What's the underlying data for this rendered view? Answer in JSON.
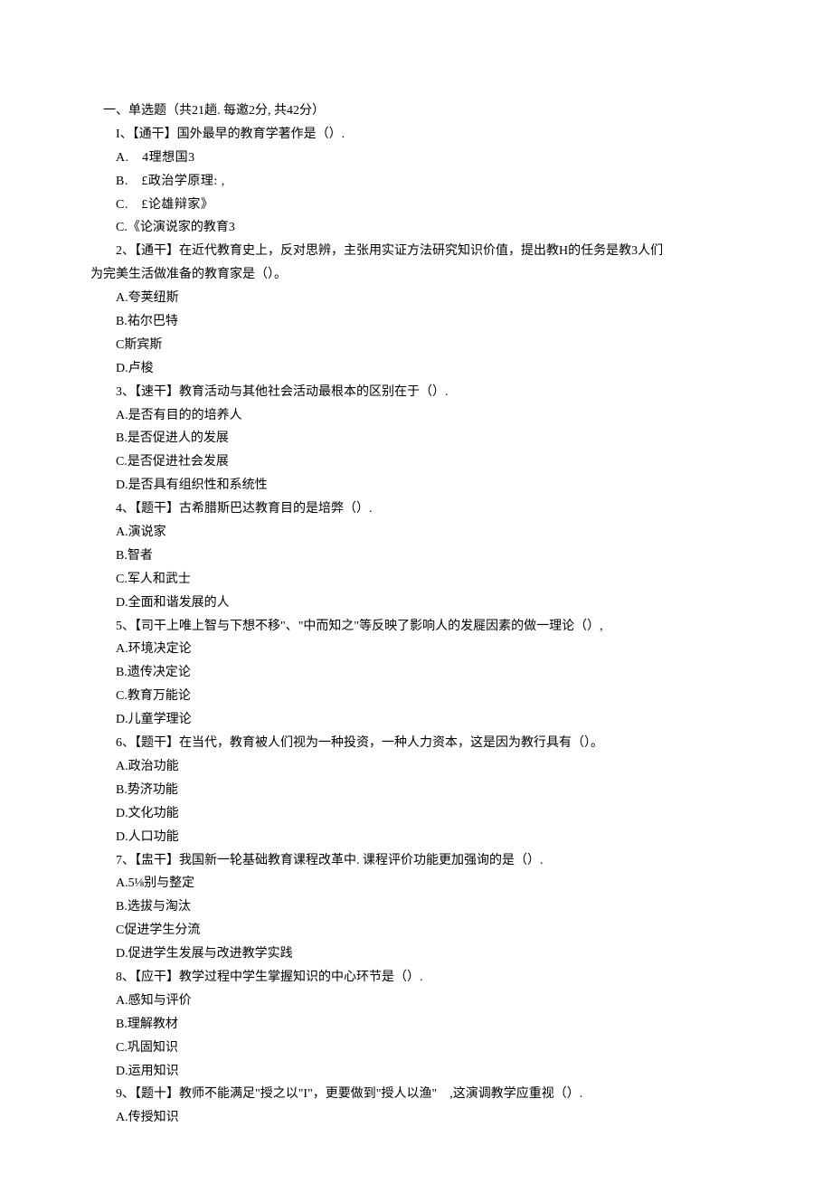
{
  "section_header": "一、单选题（共21趟. 每邀2分, 共42分）",
  "questions": [
    {
      "stem": "I、【通干】国外最早的教育学著作是（）.",
      "options": [
        "A.　4理想国3",
        "B.　£政治学原理: ,",
        "C.　£论雄辩家》",
        "C.《论演说家的教育3"
      ]
    },
    {
      "stem": "2、【通干】在近代教育史上，反对思辨，主张用实证方法研究知识价值，提出教H的任务是教3人们",
      "continuation": "为完美生活做准备的教育家是（）。",
      "options": [
        "A.夸荚纽斯",
        "B.祐尔巴特",
        "C斯宾斯",
        "D.卢梭"
      ]
    },
    {
      "stem": "3、【速干】教育活动与其他社会活动最根本的区别在于（）.",
      "options": [
        "A.是否有目的的培养人",
        "B.是否促进人的发展",
        "C.是否促进社会发展",
        "D.是否具有组织性和系统性"
      ]
    },
    {
      "stem": "4、【题干】古希腊斯巴达教育目的是培弊（）.",
      "options": [
        "A.演说家",
        "B.智者",
        "C.军人和武士",
        "D.全面和谐发展的人"
      ]
    },
    {
      "stem": "5、【司干上唯上智与下想不移\"、\"中而知之\"等反映了影响人的发屣因素的做一理论（）,",
      "options": [
        "A.环境决定论",
        "B.遗传决定论",
        "C.教育万能论",
        "D.儿童学理论"
      ]
    },
    {
      "stem": "6、【题干】在当代，教育被人们视为一种投资，一种人力资本，这是因为教行具有（）。",
      "options": [
        "A.政治功能",
        "B.势济功能",
        "D.文化功能",
        "D.人口功能"
      ]
    },
    {
      "stem": "7、【盅干】我国新一轮基础教育课程改革中. 课程评价功能更加强询的是（）.",
      "options": [
        "A.5⅛别与整定",
        "B.选拔与淘汰",
        "C促进学生分流",
        "D.促进学生发展与改进教学实践"
      ]
    },
    {
      "stem": "8、【应干】教学过程中学生掌握知识的中心环节是（）.",
      "options": [
        "A.感知与评价",
        "B.理解教材",
        "C.巩固知识",
        "D.运用知识"
      ]
    },
    {
      "stem": "9、【题十】教师不能满足\"授之以\"I\"，更要做到\"授人以渔\"　,这演调教学应重视（）.",
      "options": [
        "A.传授知识"
      ]
    }
  ]
}
